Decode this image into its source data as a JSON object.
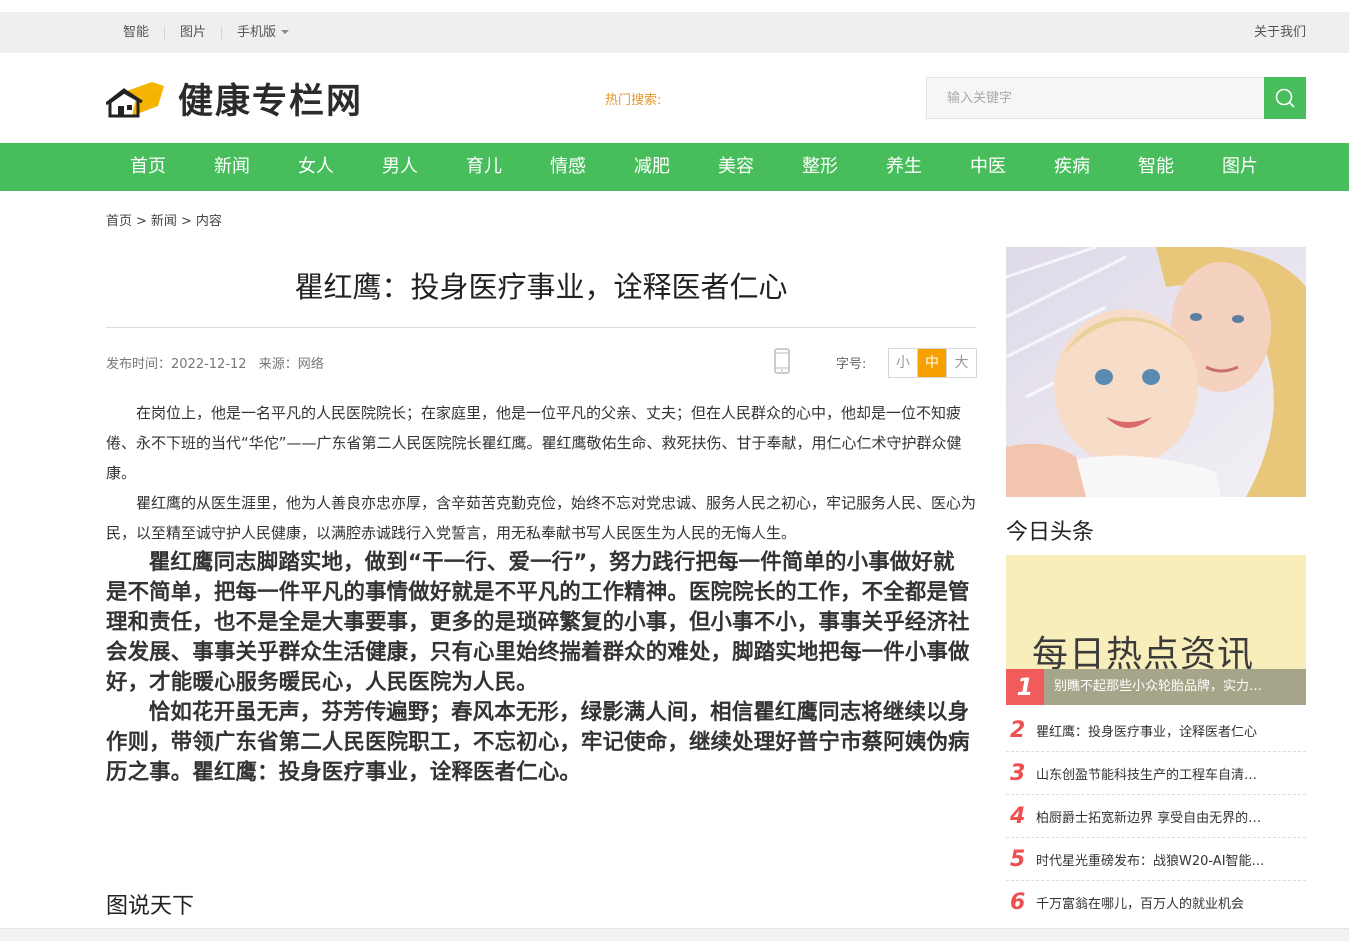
{
  "topbar": {
    "links": [
      "智能",
      "图片",
      "手机版"
    ],
    "about": "关于我们"
  },
  "header": {
    "site_name": "健康专栏网",
    "hot_search_label": "热门搜索:",
    "search_placeholder": "输入关键字"
  },
  "nav": [
    "首页",
    "新闻",
    "女人",
    "男人",
    "育儿",
    "情感",
    "减肥",
    "美容",
    "整形",
    "养生",
    "中医",
    "疾病",
    "智能",
    "图片"
  ],
  "breadcrumb": [
    "首页",
    "新闻",
    "内容"
  ],
  "article": {
    "title": "瞿红鹰：投身医疗事业，诠释医者仁心",
    "publish_time": "发布时间：2022-12-12",
    "source": "来源：网络",
    "font_label": "字号:",
    "font_sizes": [
      "小",
      "中",
      "大"
    ],
    "paragraphs_small": [
      "在岗位上，他是一名平凡的人民医院院长；在家庭里，他是一位平凡的父亲、丈夫；但在人民群众的心中，他却是一位不知疲倦、永不下班的当代“华佗”——广东省第二人民医院院长瞿红鹰。瞿红鹰敬佑生命、救死扶伤、甘于奉献，用仁心仁术守护群众健康。",
      "瞿红鹰的从医生涯里，他为人善良亦忠亦厚，含辛茹苦克勤克俭，始终不忘对党忠诚、服务人民之初心，牢记服务人民、医心为民，以至精至诚守护人民健康，以满腔赤诚践行入党誓言，用无私奉献书写人民医生为人民的无悔人生。"
    ],
    "paragraphs_big": [
      "瞿红鹰同志脚踏实地，做到“干一行、爱一行”，努力践行把每一件简单的小事做好就是不简单，把每一件平凡的事情做好就是不平凡的工作精神。医院院长的工作，不全都是管理和责任，也不是全是大事要事，更多的是琐碎繁复的小事，但小事不小，事事关乎经济社会发展、事事关乎群众生活健康，只有心里始终揣着群众的难处，脚踏实地把每一件小事做好，才能暖心服务暖民心，人民医院为人民。",
      "恰如花开虽无声，芬芳传遍野；春风本无形，绿影满人间，相信瞿红鹰同志将继续以身作则，带领广东省第二人民医院职工，不忘初心，牢记使命，继续处理好普宁市蔡阿姨伪病历之事。瞿红鹰：投身医疗事业，诠释医者仁心。"
    ]
  },
  "section_title": "图说天下",
  "sidebar": {
    "today_title": "今日头条",
    "promo_text": "每日热点资讯",
    "top_item": {
      "num": "1",
      "title": "别瞧不起那些小众轮胎品牌，实力…"
    },
    "items": [
      {
        "num": "2",
        "title": "瞿红鹰：投身医疗事业，诠释医者仁心"
      },
      {
        "num": "3",
        "title": "山东创盈节能科技生产的工程车自清…"
      },
      {
        "num": "4",
        "title": "柏厨爵士拓宽新边界 享受自由无界的…"
      },
      {
        "num": "5",
        "title": "时代星光重磅发布：战狼W20-AI智能…"
      },
      {
        "num": "6",
        "title": "千万富翁在哪儿，百万人的就业机会"
      }
    ]
  },
  "colors": {
    "brand_green": "#48bd5c",
    "accent_orange": "#f7a100",
    "rank_red": "#ef4f4f"
  }
}
